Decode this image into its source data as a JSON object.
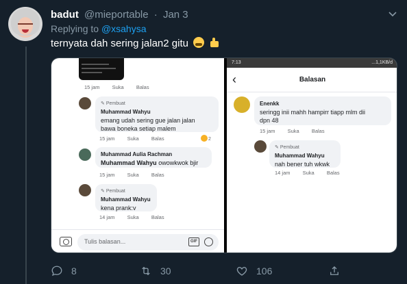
{
  "tweet": {
    "display_name": "badut",
    "handle": "@mieportable",
    "separator": "·",
    "date": "Jan 3",
    "replying_prefix": "Replying to",
    "replying_to": "@xsahysa",
    "text": "ternyata dah sering jalan2 gitu",
    "emojis": [
      "loudly-crying-face",
      "thumbs-up"
    ]
  },
  "left_screenshot": {
    "top_meta": {
      "time": "15 jam",
      "like": "Suka",
      "reply": "Balas"
    },
    "comments": [
      {
        "badge": "Pembuat",
        "author": "Muhammad Wahyu",
        "text_line1": "emang udah sering gue jalan jalan",
        "text_line2": "bawa boneka setiap malem",
        "time": "15 jam",
        "like": "Suka",
        "reply": "Balas",
        "reaction_count": "2"
      },
      {
        "author": "Muhammad Aulia Rachman",
        "mention": "Muhammad Wahyu",
        "text": "owowkwok bjir",
        "time": "15 jam",
        "like": "Suka",
        "reply": "Balas"
      },
      {
        "badge": "Pembuat",
        "author": "Muhammad Wahyu",
        "text": "kena prank:v",
        "time": "14 jam",
        "like": "Suka",
        "reply": "Balas"
      }
    ],
    "input_placeholder": "Tulis balasan...",
    "gif_label": "GIF"
  },
  "right_screenshot": {
    "status_time": "7:13",
    "status_net": "...1,1KB/d",
    "title": "Balasan",
    "comments": [
      {
        "author": "Enenkk",
        "text_line1": "seringg inii mahh hampirr tiapp mlm dii",
        "text_line2": "dpn 48",
        "time": "15 jam",
        "like": "Suka",
        "reply": "Balas"
      },
      {
        "badge": "Pembuat",
        "author": "Muhammad Wahyu",
        "text": "nah bener tuh wkwk",
        "time": "14 jam",
        "like": "Suka",
        "reply": "Balas"
      }
    ]
  },
  "actions": {
    "replies": "8",
    "retweets": "30",
    "likes": "106"
  },
  "colors": {
    "background": "#15202b",
    "muted": "#8899a6",
    "link": "#1da1f2"
  }
}
